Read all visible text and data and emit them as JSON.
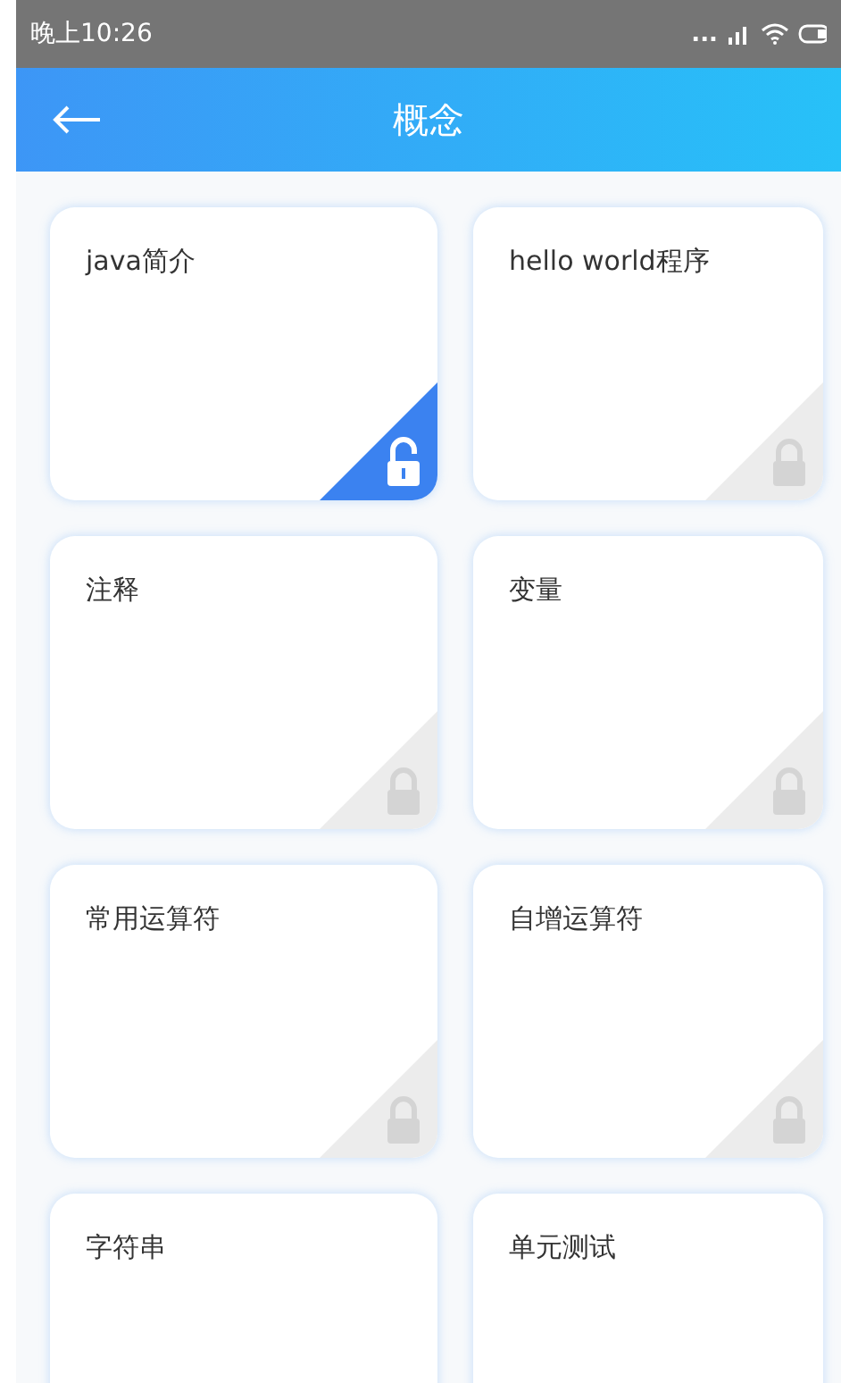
{
  "status_bar": {
    "time": "晚上10:26",
    "dots": "..."
  },
  "header": {
    "title": "概念"
  },
  "lessons": [
    {
      "title": "java简介",
      "unlocked": true
    },
    {
      "title": "hello world程序",
      "unlocked": false
    },
    {
      "title": "注释",
      "unlocked": false
    },
    {
      "title": "变量",
      "unlocked": false
    },
    {
      "title": "常用运算符",
      "unlocked": false
    },
    {
      "title": "自增运算符",
      "unlocked": false
    },
    {
      "title": "字符串"
    },
    {
      "title": "单元测试"
    }
  ]
}
